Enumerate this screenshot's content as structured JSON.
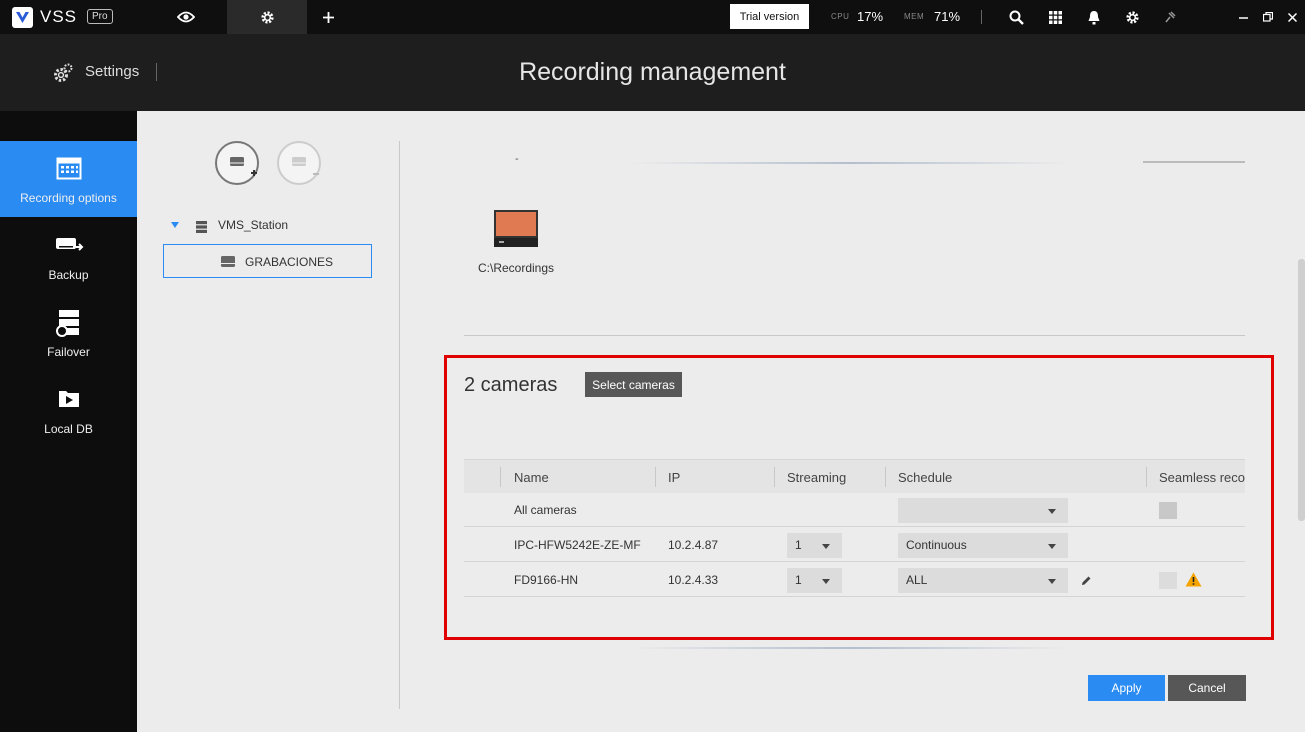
{
  "topbar": {
    "logo": "VSS",
    "logo_badge": "Pro",
    "tabs": [
      {
        "icon": "eye-icon",
        "active": false
      },
      {
        "icon": "gear-icon",
        "active": true
      },
      {
        "icon": "plus-icon",
        "active": false
      }
    ],
    "trial_label": "Trial version",
    "cpu_label": "CPU",
    "cpu_value": "17%",
    "mem_label": "MEM",
    "mem_value": "71%",
    "window_icons": [
      "search-icon",
      "grid-icon",
      "bell-icon",
      "gear-icon",
      "pin-icon",
      "minimize-icon",
      "restore-icon",
      "close-icon"
    ]
  },
  "header": {
    "section": "Settings",
    "title": "Recording management"
  },
  "sidebar": {
    "items": [
      {
        "label": "Recording options",
        "icon": "calendar-icon",
        "active": true
      },
      {
        "label": "Backup",
        "icon": "backup-icon",
        "active": false
      },
      {
        "label": "Failover",
        "icon": "failover-icon",
        "active": false
      },
      {
        "label": "Local DB",
        "icon": "local-db-icon",
        "active": false
      }
    ]
  },
  "tree": {
    "station": "VMS_Station",
    "node": "GRABACIONES"
  },
  "storage": {
    "dash": "-",
    "path": "C:\\Recordings"
  },
  "cameras": {
    "count_label": "2 cameras",
    "select_button": "Select cameras",
    "columns": [
      "Name",
      "IP",
      "Streaming",
      "Schedule",
      "Seamless reco"
    ],
    "all_row": {
      "name": "All cameras",
      "schedule": ""
    },
    "rows": [
      {
        "name": "IPC-HFW5242E-ZE-MF",
        "ip": "10.2.4.87",
        "streaming": "1",
        "schedule": "Continuous"
      },
      {
        "name": "FD9166-HN",
        "ip": "10.2.4.33",
        "streaming": "1",
        "schedule": "ALL"
      }
    ]
  },
  "actions": {
    "apply": "Apply",
    "cancel": "Cancel"
  },
  "colors": {
    "accent": "#2a8bf2",
    "highlight": "#e00000",
    "warning": "#f5a300"
  }
}
